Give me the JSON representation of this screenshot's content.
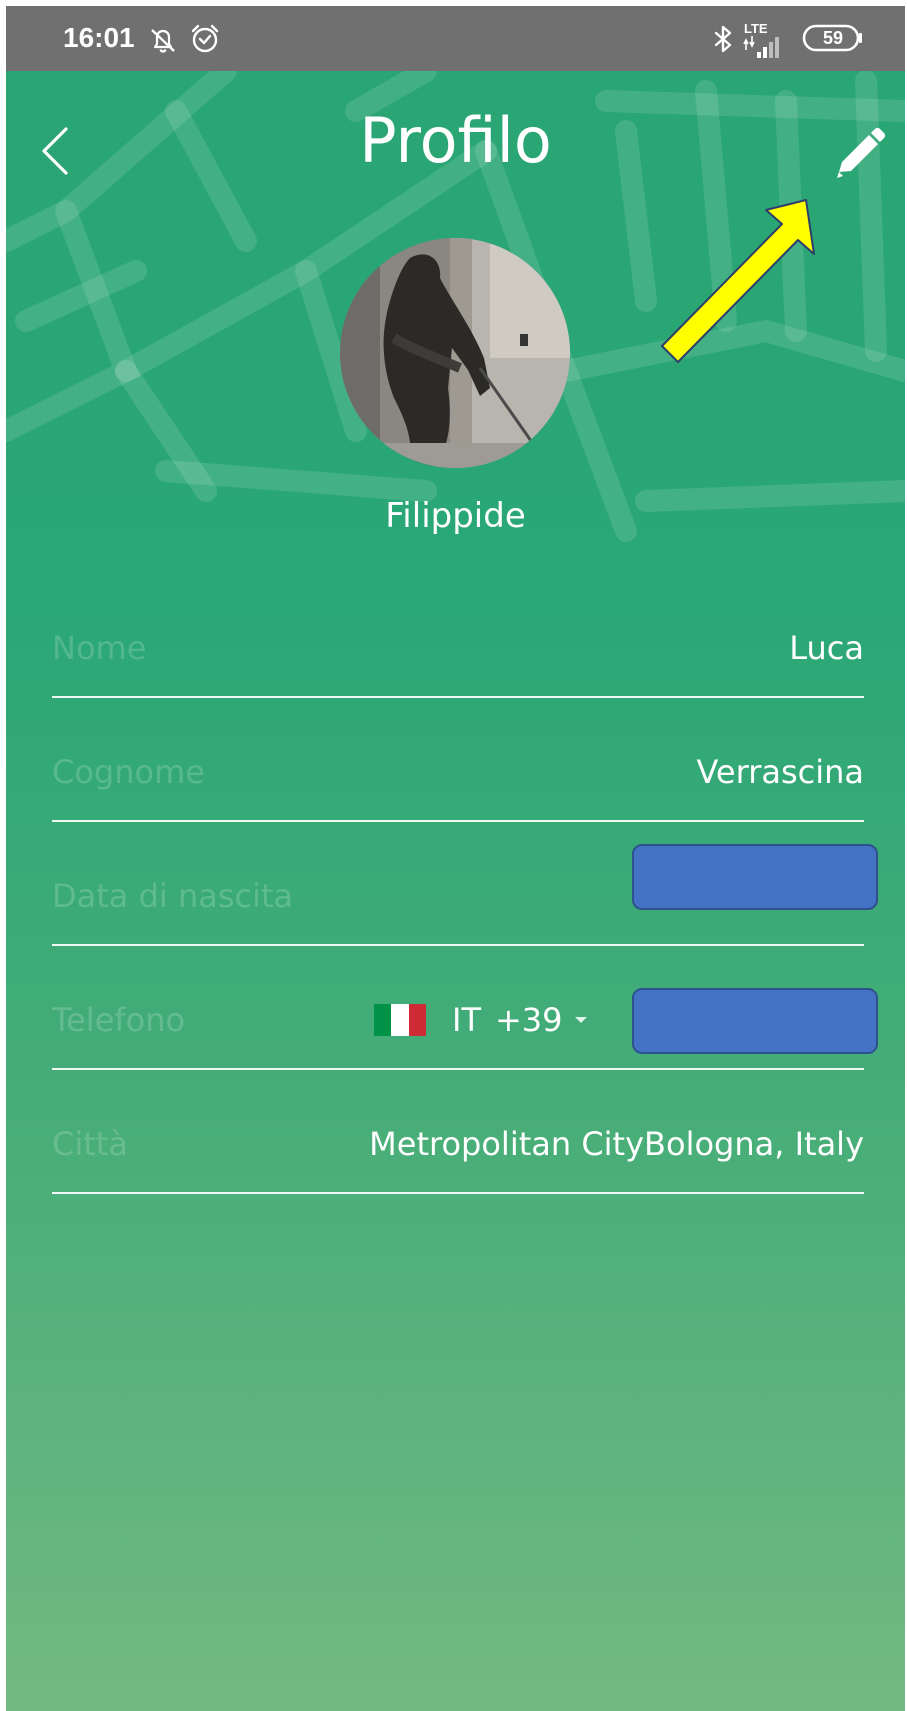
{
  "statusbar": {
    "time": "16:01",
    "network": "LTE",
    "battery": "59",
    "icons": [
      "bell-off-icon",
      "alarm-icon",
      "bluetooth-icon",
      "signal-icon",
      "battery-icon"
    ]
  },
  "header": {
    "title": "Profilo",
    "back_icon": "chevron-left-icon",
    "edit_icon": "pencil-icon"
  },
  "profile": {
    "username": "Filippide",
    "avatar": "profile-photo"
  },
  "fields": [
    {
      "label": "Nome",
      "value": "Luca"
    },
    {
      "label": "Cognome",
      "value": "Verrascina"
    },
    {
      "label": "Data di nascita",
      "value": ""
    },
    {
      "label": "Telefono",
      "country": "IT",
      "dial_code": "+39",
      "value": ""
    },
    {
      "label": "Città",
      "value": "Metropolitan CityBologna, Italy"
    }
  ],
  "colors": {
    "gradient_top": "#2aa574",
    "gradient_bottom": "#73b982",
    "statusbar": "#707070",
    "redaction": "#4472c4",
    "annotation_arrow": "#ffff00",
    "flag_green": "#009246",
    "flag_white": "#ffffff",
    "flag_red": "#ce2b37"
  }
}
